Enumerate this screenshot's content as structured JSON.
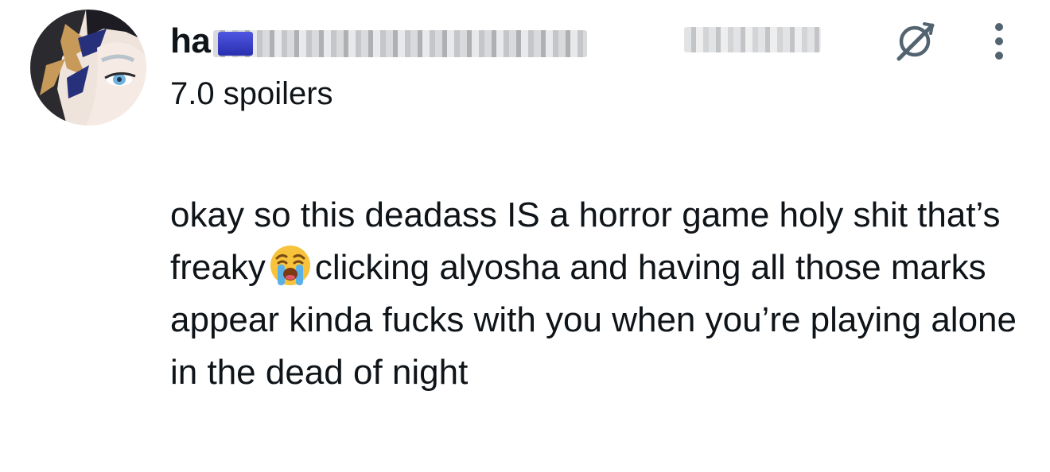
{
  "post": {
    "author": {
      "display_name_visible": "ha",
      "subtitle": "7.0 spoilers"
    },
    "text_part1": "okay so this deadass IS a horror game holy shit that’s freaky",
    "text_part2": "clicking alyosha and having all those marks appear kinda fucks with you when you’re playing alone in the dead of night",
    "emoji": "loudly-crying-face-icon",
    "icons": {
      "grok": "grok-icon",
      "more": "more-vertical-icon"
    }
  },
  "colors": {
    "text": "#0f1419",
    "background": "#ffffff",
    "icon": "#536471",
    "emoji_face": "#f7c33c",
    "emoji_tears": "#5ab0e8"
  }
}
